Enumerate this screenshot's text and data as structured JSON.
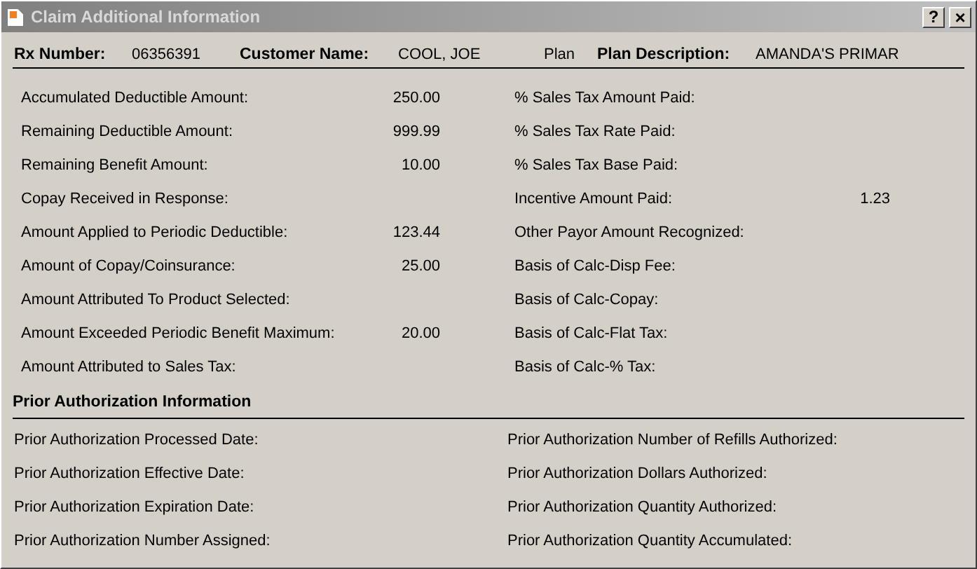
{
  "window": {
    "title": "Claim Additional Information",
    "buttons": [
      {
        "kind": "help",
        "text": "?"
      },
      {
        "kind": "close",
        "text": "×"
      }
    ]
  },
  "header": [
    {
      "kind": "label",
      "text": "Rx Number:"
    },
    {
      "kind": "value",
      "text": "06356391"
    },
    {
      "kind": "label",
      "text": "Customer Name:"
    },
    {
      "kind": "value",
      "text": "COOL, JOE"
    },
    {
      "kind": "value",
      "text": "Plan"
    },
    {
      "kind": "label",
      "text": "Plan Description:"
    },
    {
      "kind": "value",
      "text": "AMANDA'S PRIMAR"
    }
  ],
  "claim_fields": {
    "left": [
      {
        "label": "Accumulated Deductible Amount:",
        "value": "250.00"
      },
      {
        "label": "Remaining Deductible Amount:",
        "value": "999.99"
      },
      {
        "label": "Remaining Benefit Amount:",
        "value": "10.00"
      },
      {
        "label": "Copay Received in Response:"
      },
      {
        "label": "Amount Applied to Periodic Deductible:",
        "value": "123.44"
      },
      {
        "label": "Amount of Copay/Coinsurance:",
        "value": "25.00"
      },
      {
        "label": "Amount Attributed To Product Selected:"
      },
      {
        "label": "Amount Exceeded Periodic Benefit Maximum:",
        "value": "20.00"
      },
      {
        "label": "Amount Attributed to Sales Tax:"
      }
    ],
    "right": [
      {
        "label": "% Sales Tax Amount Paid:"
      },
      {
        "label": "% Sales Tax Rate Paid:"
      },
      {
        "label": "% Sales Tax Base Paid:"
      },
      {
        "label": "Incentive Amount Paid:",
        "value": "1.23"
      },
      {
        "label": "Other Payor Amount Recognized:"
      },
      {
        "label": "Basis of Calc-Disp Fee:"
      },
      {
        "label": "Basis of Calc-Copay:"
      },
      {
        "label": "Basis of Calc-Flat Tax:"
      },
      {
        "label": "Basis of Calc-% Tax:"
      }
    ]
  },
  "prior_authorization": {
    "title": "Prior Authorization Information",
    "left": [
      {
        "label": "Prior Authorization Processed Date:"
      },
      {
        "label": "Prior Authorization Effective Date:"
      },
      {
        "label": "Prior Authorization Expiration Date:"
      },
      {
        "label": "Prior Authorization Number Assigned:"
      }
    ],
    "right": [
      {
        "label": "Prior Authorization Number of Refills Authorized:"
      },
      {
        "label": "Prior Authorization Dollars Authorized:"
      },
      {
        "label": "Prior Authorization Quantity Authorized:"
      },
      {
        "label": "Prior Authorization Quantity Accumulated:"
      }
    ]
  }
}
